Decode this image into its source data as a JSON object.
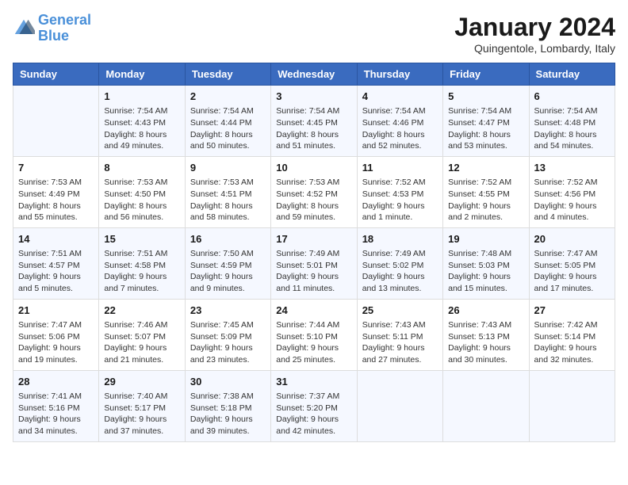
{
  "header": {
    "logo_line1": "General",
    "logo_line2": "Blue",
    "month": "January 2024",
    "location": "Quingentole, Lombardy, Italy"
  },
  "days_of_week": [
    "Sunday",
    "Monday",
    "Tuesday",
    "Wednesday",
    "Thursday",
    "Friday",
    "Saturday"
  ],
  "weeks": [
    [
      {
        "day": "",
        "info": ""
      },
      {
        "day": "1",
        "info": "Sunrise: 7:54 AM\nSunset: 4:43 PM\nDaylight: 8 hours\nand 49 minutes."
      },
      {
        "day": "2",
        "info": "Sunrise: 7:54 AM\nSunset: 4:44 PM\nDaylight: 8 hours\nand 50 minutes."
      },
      {
        "day": "3",
        "info": "Sunrise: 7:54 AM\nSunset: 4:45 PM\nDaylight: 8 hours\nand 51 minutes."
      },
      {
        "day": "4",
        "info": "Sunrise: 7:54 AM\nSunset: 4:46 PM\nDaylight: 8 hours\nand 52 minutes."
      },
      {
        "day": "5",
        "info": "Sunrise: 7:54 AM\nSunset: 4:47 PM\nDaylight: 8 hours\nand 53 minutes."
      },
      {
        "day": "6",
        "info": "Sunrise: 7:54 AM\nSunset: 4:48 PM\nDaylight: 8 hours\nand 54 minutes."
      }
    ],
    [
      {
        "day": "7",
        "info": "Sunrise: 7:53 AM\nSunset: 4:49 PM\nDaylight: 8 hours\nand 55 minutes."
      },
      {
        "day": "8",
        "info": "Sunrise: 7:53 AM\nSunset: 4:50 PM\nDaylight: 8 hours\nand 56 minutes."
      },
      {
        "day": "9",
        "info": "Sunrise: 7:53 AM\nSunset: 4:51 PM\nDaylight: 8 hours\nand 58 minutes."
      },
      {
        "day": "10",
        "info": "Sunrise: 7:53 AM\nSunset: 4:52 PM\nDaylight: 8 hours\nand 59 minutes."
      },
      {
        "day": "11",
        "info": "Sunrise: 7:52 AM\nSunset: 4:53 PM\nDaylight: 9 hours\nand 1 minute."
      },
      {
        "day": "12",
        "info": "Sunrise: 7:52 AM\nSunset: 4:55 PM\nDaylight: 9 hours\nand 2 minutes."
      },
      {
        "day": "13",
        "info": "Sunrise: 7:52 AM\nSunset: 4:56 PM\nDaylight: 9 hours\nand 4 minutes."
      }
    ],
    [
      {
        "day": "14",
        "info": "Sunrise: 7:51 AM\nSunset: 4:57 PM\nDaylight: 9 hours\nand 5 minutes."
      },
      {
        "day": "15",
        "info": "Sunrise: 7:51 AM\nSunset: 4:58 PM\nDaylight: 9 hours\nand 7 minutes."
      },
      {
        "day": "16",
        "info": "Sunrise: 7:50 AM\nSunset: 4:59 PM\nDaylight: 9 hours\nand 9 minutes."
      },
      {
        "day": "17",
        "info": "Sunrise: 7:49 AM\nSunset: 5:01 PM\nDaylight: 9 hours\nand 11 minutes."
      },
      {
        "day": "18",
        "info": "Sunrise: 7:49 AM\nSunset: 5:02 PM\nDaylight: 9 hours\nand 13 minutes."
      },
      {
        "day": "19",
        "info": "Sunrise: 7:48 AM\nSunset: 5:03 PM\nDaylight: 9 hours\nand 15 minutes."
      },
      {
        "day": "20",
        "info": "Sunrise: 7:47 AM\nSunset: 5:05 PM\nDaylight: 9 hours\nand 17 minutes."
      }
    ],
    [
      {
        "day": "21",
        "info": "Sunrise: 7:47 AM\nSunset: 5:06 PM\nDaylight: 9 hours\nand 19 minutes."
      },
      {
        "day": "22",
        "info": "Sunrise: 7:46 AM\nSunset: 5:07 PM\nDaylight: 9 hours\nand 21 minutes."
      },
      {
        "day": "23",
        "info": "Sunrise: 7:45 AM\nSunset: 5:09 PM\nDaylight: 9 hours\nand 23 minutes."
      },
      {
        "day": "24",
        "info": "Sunrise: 7:44 AM\nSunset: 5:10 PM\nDaylight: 9 hours\nand 25 minutes."
      },
      {
        "day": "25",
        "info": "Sunrise: 7:43 AM\nSunset: 5:11 PM\nDaylight: 9 hours\nand 27 minutes."
      },
      {
        "day": "26",
        "info": "Sunrise: 7:43 AM\nSunset: 5:13 PM\nDaylight: 9 hours\nand 30 minutes."
      },
      {
        "day": "27",
        "info": "Sunrise: 7:42 AM\nSunset: 5:14 PM\nDaylight: 9 hours\nand 32 minutes."
      }
    ],
    [
      {
        "day": "28",
        "info": "Sunrise: 7:41 AM\nSunset: 5:16 PM\nDaylight: 9 hours\nand 34 minutes."
      },
      {
        "day": "29",
        "info": "Sunrise: 7:40 AM\nSunset: 5:17 PM\nDaylight: 9 hours\nand 37 minutes."
      },
      {
        "day": "30",
        "info": "Sunrise: 7:38 AM\nSunset: 5:18 PM\nDaylight: 9 hours\nand 39 minutes."
      },
      {
        "day": "31",
        "info": "Sunrise: 7:37 AM\nSunset: 5:20 PM\nDaylight: 9 hours\nand 42 minutes."
      },
      {
        "day": "",
        "info": ""
      },
      {
        "day": "",
        "info": ""
      },
      {
        "day": "",
        "info": ""
      }
    ]
  ]
}
